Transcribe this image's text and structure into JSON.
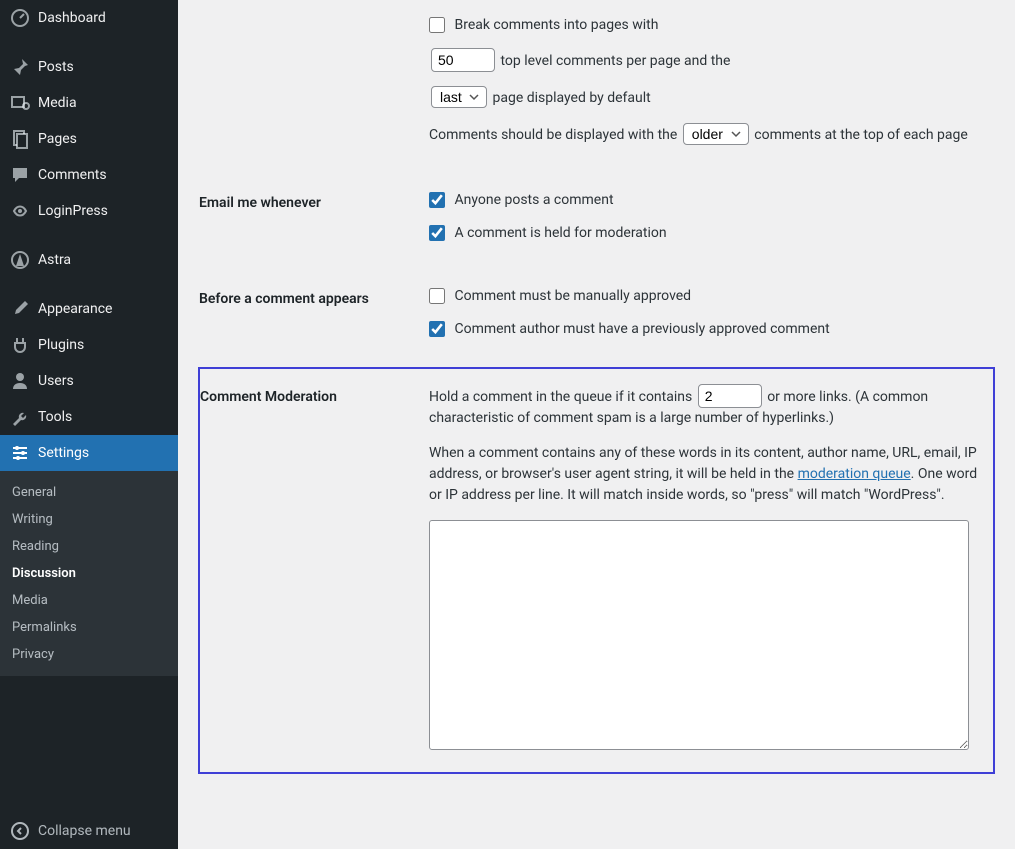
{
  "sidebar": {
    "items": [
      {
        "label": "Dashboard",
        "icon": "dashboard"
      },
      {
        "label": "Posts",
        "icon": "pin"
      },
      {
        "label": "Media",
        "icon": "media"
      },
      {
        "label": "Pages",
        "icon": "pages"
      },
      {
        "label": "Comments",
        "icon": "comments"
      },
      {
        "label": "LoginPress",
        "icon": "loginpress"
      },
      {
        "label": "Astra",
        "icon": "astra"
      },
      {
        "label": "Appearance",
        "icon": "brush"
      },
      {
        "label": "Plugins",
        "icon": "plug"
      },
      {
        "label": "Users",
        "icon": "user"
      },
      {
        "label": "Tools",
        "icon": "wrench"
      },
      {
        "label": "Settings",
        "icon": "sliders",
        "current": true
      }
    ],
    "submenu": [
      "General",
      "Writing",
      "Reading",
      "Discussion",
      "Media",
      "Permalinks",
      "Privacy"
    ],
    "submenu_active": "Discussion",
    "collapse_label": "Collapse menu"
  },
  "settings": {
    "break_comments": {
      "label": "Break comments into pages with",
      "per_page_value": "50",
      "per_page_suffix": "top level comments per page and the",
      "default_page_value": "last",
      "default_page_suffix": "page displayed by default",
      "display_prefix": "Comments should be displayed with the",
      "display_order_value": "older",
      "display_suffix": "comments at the top of each page"
    },
    "email_me": {
      "heading": "Email me whenever",
      "opt1": "Anyone posts a comment",
      "opt2": "A comment is held for moderation"
    },
    "before_appears": {
      "heading": "Before a comment appears",
      "opt1": "Comment must be manually approved",
      "opt2": "Comment author must have a previously approved comment"
    },
    "moderation": {
      "heading": "Comment Moderation",
      "hold_prefix": "Hold a comment in the queue if it contains",
      "hold_value": "2",
      "hold_suffix": "or more links. (A common characteristic of comment spam is a large number of hyperlinks.)",
      "desc_pre": "When a comment contains any of these words in its content, author name, URL, email, IP address, or browser's user agent string, it will be held in the ",
      "link_text": "moderation queue",
      "desc_post": ". One word or IP address per line. It will match inside words, so \"press\" will match \"WordPress\"."
    }
  }
}
